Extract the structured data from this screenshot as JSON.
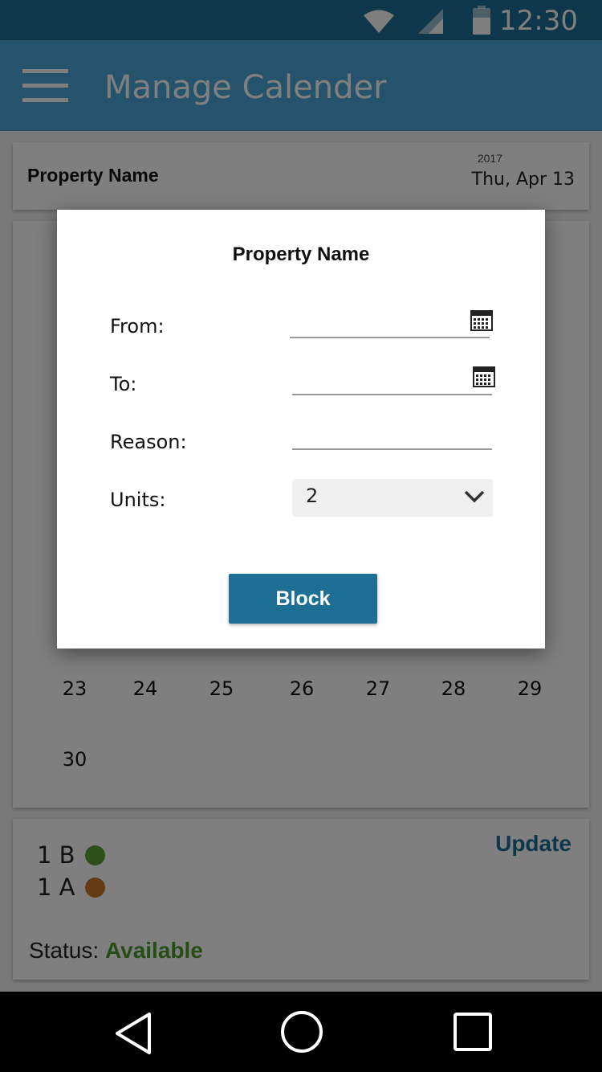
{
  "status_bar": {
    "time": "12:30"
  },
  "app_bar": {
    "title": "Manage Calender"
  },
  "property_card": {
    "name": "Property Name",
    "year": "2017",
    "date": "Thu, Apr 13"
  },
  "calendar": {
    "week_row": [
      "23",
      "24",
      "25",
      "26",
      "27",
      "28",
      "29"
    ],
    "last_row": [
      "30"
    ]
  },
  "units": {
    "items": [
      {
        "label": "1 B",
        "color": "#5a9e32"
      },
      {
        "label": "1 A",
        "color": "#c8772a"
      }
    ],
    "update_label": "Update",
    "status_label": "Status:",
    "status_value": "Available",
    "status_color": "#4e9a2e"
  },
  "modal": {
    "title": "Property Name",
    "from_label": "From:",
    "to_label": "To:",
    "reason_label": "Reason:",
    "units_label": "Units:",
    "units_value": "2",
    "block_label": "Block"
  },
  "colors": {
    "primary": "#1d6f96",
    "app_bar": "#4aa6d6"
  }
}
